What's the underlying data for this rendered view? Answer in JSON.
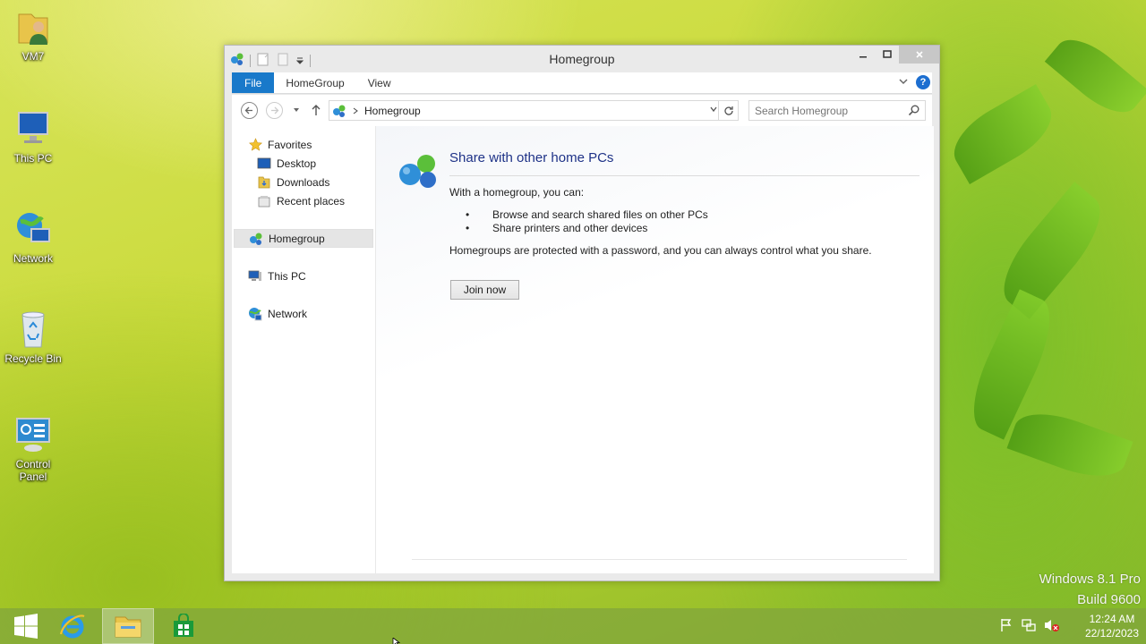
{
  "desktop": {
    "icons": [
      {
        "label": "VM7"
      },
      {
        "label": "This PC"
      },
      {
        "label": "Network"
      },
      {
        "label": "Recycle Bin"
      },
      {
        "label": "Control Panel"
      }
    ],
    "watermark": {
      "line1": "Windows 8.1 Pro",
      "line2": "Build 9600"
    }
  },
  "window": {
    "title": "Homegroup",
    "ribbon": {
      "tabs": [
        {
          "label": "File"
        },
        {
          "label": "HomeGroup"
        },
        {
          "label": "View"
        }
      ],
      "help_label": "?"
    },
    "address": {
      "crumb": "Homegroup"
    },
    "search": {
      "placeholder": "Search Homegroup"
    },
    "nav": {
      "favorites": "Favorites",
      "desktop": "Desktop",
      "downloads": "Downloads",
      "recent": "Recent places",
      "homegroup": "Homegroup",
      "thispc": "This PC",
      "network": "Network"
    },
    "content": {
      "heading": "Share with other home PCs",
      "intro": "With a homegroup, you can:",
      "bullets": [
        "Browse and search shared files on other PCs",
        "Share printers and other devices"
      ],
      "protect": "Homegroups are protected with a password, and you can always control what you share.",
      "join_label": "Join now"
    }
  },
  "taskbar": {
    "clock": {
      "time": "12:24 AM",
      "date": "22/12/2023"
    }
  },
  "colors": {
    "accent": "#1979ca",
    "heading": "#1e3287"
  }
}
